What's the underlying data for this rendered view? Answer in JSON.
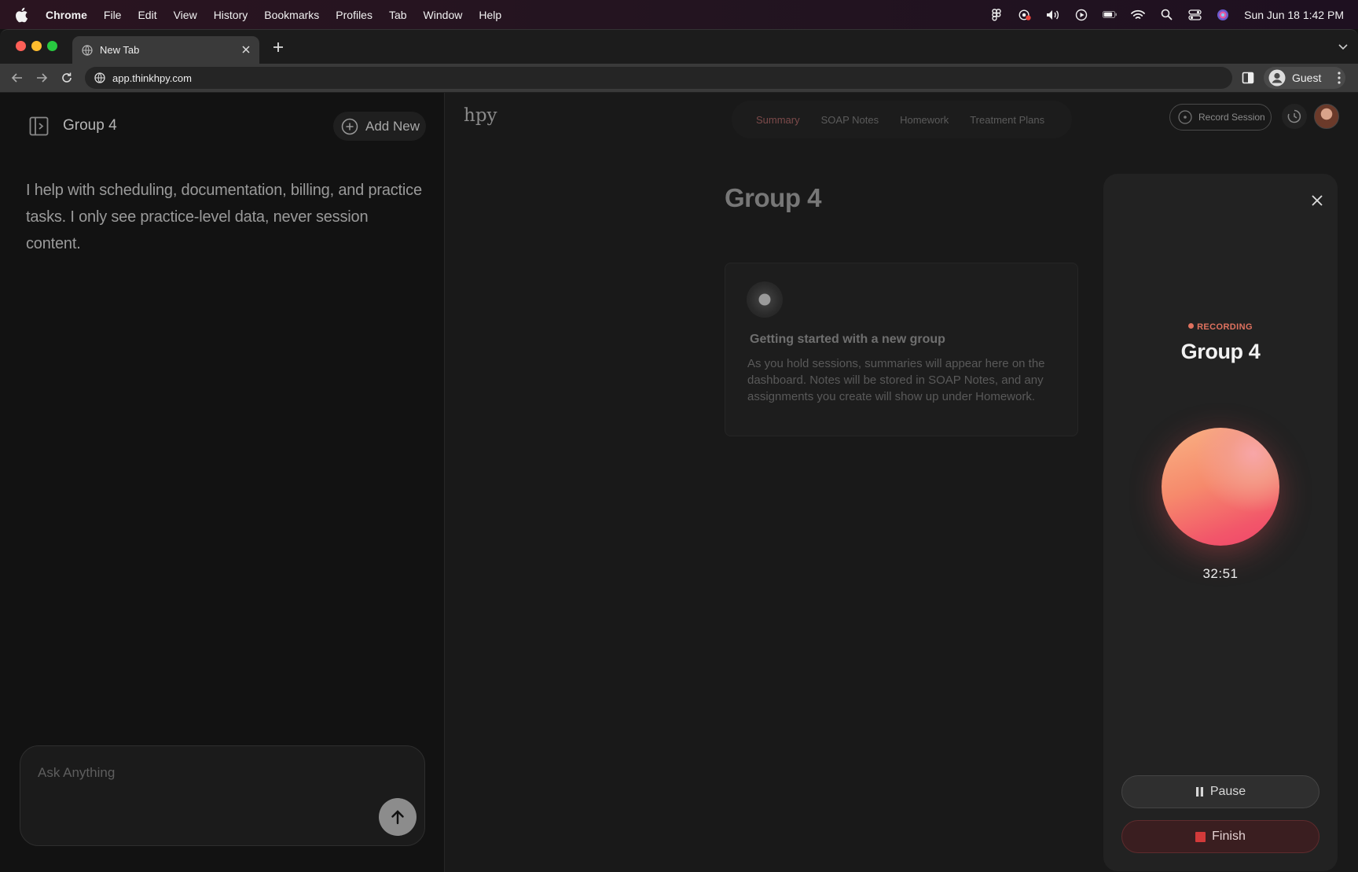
{
  "menubar": {
    "items": [
      "Chrome",
      "File",
      "Edit",
      "View",
      "History",
      "Bookmarks",
      "Profiles",
      "Tab",
      "Window",
      "Help"
    ],
    "clock": "Sun Jun 18  1:42 PM"
  },
  "browser": {
    "tab_title": "New Tab",
    "url": "app.thinkhpy.com",
    "profile_label": "Guest"
  },
  "left_pane": {
    "title": "Group 4",
    "add_new_label": "Add New",
    "assistant_text": "I help with scheduling, documentation, billing, and practice tasks. I only see practice-level data,  never session content.",
    "ask_placeholder": "Ask Anything"
  },
  "main": {
    "brand": "hpy",
    "tabs": [
      {
        "label": "Summary",
        "active": true
      },
      {
        "label": "SOAP Notes",
        "active": false
      },
      {
        "label": "Homework",
        "active": false
      },
      {
        "label": "Treatment Plans",
        "active": false
      }
    ],
    "record_button_label": "Record Session",
    "group_title": "Group 4",
    "card": {
      "title": "Getting started with a new group",
      "body": "As you hold sessions, summaries will appear here on the dashboard. Notes will be stored in SOAP Notes, and any assignments you create will show up under Homework."
    }
  },
  "recording_panel": {
    "status": "RECORDING",
    "title": "Group 4",
    "timer": "32:51",
    "pause_label": "Pause",
    "finish_label": "Finish",
    "accent_color": "#e0725f"
  }
}
